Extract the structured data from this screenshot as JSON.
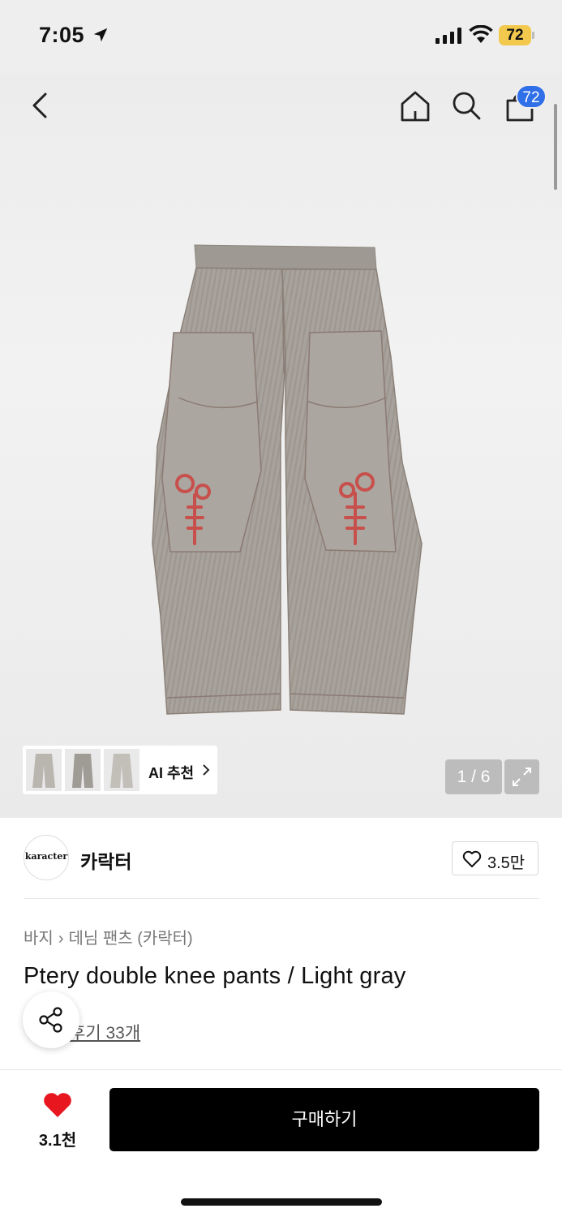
{
  "status_bar": {
    "time": "7:05",
    "battery": "72"
  },
  "header": {
    "cart_count": "72"
  },
  "gallery": {
    "ai_label": "AI 추천",
    "counter": "1 / 6",
    "thumbnail_count": 3
  },
  "brand": {
    "logo_text": "karacter",
    "name": "카락터",
    "likes": "3.5만"
  },
  "breadcrumb": [
    "바지",
    "데님 팬츠 (카락터)"
  ],
  "product": {
    "title": "Ptery double knee pants / Light gray",
    "reviews": "후기 33개"
  },
  "bottom": {
    "wish_count": "3.1천",
    "buy_label": "구매하기"
  },
  "colors": {
    "badge": "#2f6fe8",
    "battery": "#f2c94c",
    "heart": "#e8171f",
    "buy_button": "#000000",
    "embroidery": "#c8504c"
  }
}
